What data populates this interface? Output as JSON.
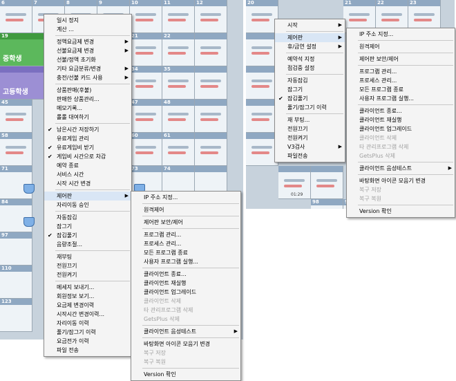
{
  "grid": {
    "top_row_numbers": [
      "6",
      "7",
      "8",
      "9",
      "10",
      "11",
      "12"
    ],
    "row19_number": "19",
    "row19_label": "중학생",
    "row32_label": "고등학생",
    "row45_number": "45",
    "row58_number": "58",
    "row71_number": "71",
    "row84_number": "84",
    "row97_number": "97",
    "row110_number": "110",
    "row123_number": "123",
    "col_numbers": [
      "21",
      "34",
      "47",
      "60",
      "73",
      "86",
      "99"
    ],
    "col2_numbers": [
      "22",
      "35",
      "48",
      "61",
      "74",
      "87",
      "100"
    ],
    "right_top_numbers": [
      "20",
      "21",
      "22",
      "23"
    ],
    "right_bottom_numbers": [
      "98",
      "99"
    ],
    "time_label": "01:29"
  },
  "menu_left": {
    "items": [
      {
        "label": "일시 정지",
        "checked": false,
        "submenu": false,
        "disabled": false
      },
      {
        "label": "계산 ...",
        "checked": false,
        "submenu": false,
        "disabled": false
      },
      {
        "sep": true
      },
      {
        "label": "정액요금제 변경",
        "checked": false,
        "submenu": true,
        "disabled": false
      },
      {
        "label": "선불요금제 변경",
        "checked": false,
        "submenu": true,
        "disabled": false
      },
      {
        "label": "선불/정액 초기화",
        "checked": false,
        "submenu": false,
        "disabled": false
      },
      {
        "label": "기타 요금분류/변경",
        "checked": false,
        "submenu": true,
        "disabled": false
      },
      {
        "label": "충전/선불 카드 사용",
        "checked": false,
        "submenu": true,
        "disabled": false
      },
      {
        "sep": true
      },
      {
        "label": "상품판매(후불)",
        "checked": false,
        "submenu": false,
        "disabled": false
      },
      {
        "label": "판매한 상품관리...",
        "checked": false,
        "submenu": false,
        "disabled": false
      },
      {
        "label": "메모기록...",
        "checked": false,
        "submenu": false,
        "disabled": false
      },
      {
        "label": "롤롤 대여하기",
        "checked": false,
        "submenu": false,
        "disabled": false
      },
      {
        "sep": true
      },
      {
        "label": "남은시간 저장하기",
        "checked": true,
        "submenu": false,
        "disabled": false
      },
      {
        "label": "유료게임 관리",
        "checked": false,
        "submenu": false,
        "disabled": false
      },
      {
        "label": "유료게임비 받기",
        "checked": true,
        "submenu": false,
        "disabled": false
      },
      {
        "label": "게임비 시간으로 차감",
        "checked": true,
        "submenu": false,
        "disabled": false
      },
      {
        "label": "예약 종료",
        "checked": false,
        "submenu": false,
        "disabled": false
      },
      {
        "label": "서비스 시간",
        "checked": false,
        "submenu": false,
        "disabled": false
      },
      {
        "label": "시작 시간 변경",
        "checked": false,
        "submenu": false,
        "disabled": false
      },
      {
        "sep": true
      },
      {
        "label": "제어판",
        "checked": false,
        "submenu": true,
        "disabled": false,
        "highlight": true
      },
      {
        "label": "자리이동 승인",
        "checked": false,
        "submenu": false,
        "disabled": false
      },
      {
        "sep": true
      },
      {
        "label": "자동잠김",
        "checked": false,
        "submenu": false,
        "disabled": false
      },
      {
        "label": "잠그기",
        "checked": false,
        "submenu": false,
        "disabled": false
      },
      {
        "label": "잠김풀기",
        "checked": true,
        "submenu": false,
        "disabled": false
      },
      {
        "label": "음량조절...",
        "checked": false,
        "submenu": false,
        "disabled": false
      },
      {
        "sep": true
      },
      {
        "label": "재부팅",
        "checked": false,
        "submenu": false,
        "disabled": false
      },
      {
        "label": "전원끄기",
        "checked": false,
        "submenu": false,
        "disabled": false
      },
      {
        "label": "전원켜기",
        "checked": false,
        "submenu": false,
        "disabled": false
      },
      {
        "sep": true
      },
      {
        "label": "메세지 보내기...",
        "checked": false,
        "submenu": false,
        "disabled": false
      },
      {
        "label": "회원정보 보기...",
        "checked": false,
        "submenu": false,
        "disabled": false
      },
      {
        "label": "요금제 변경이력",
        "checked": false,
        "submenu": false,
        "disabled": false
      },
      {
        "label": "시작시간 변경이력...",
        "checked": false,
        "submenu": false,
        "disabled": false
      },
      {
        "label": "자리이동 이력",
        "checked": false,
        "submenu": false,
        "disabled": false
      },
      {
        "label": "풀기/잠그기 이력",
        "checked": false,
        "submenu": false,
        "disabled": false
      },
      {
        "label": "요금전가 이력",
        "checked": false,
        "submenu": false,
        "disabled": false
      },
      {
        "label": "파일 전송",
        "checked": false,
        "submenu": false,
        "disabled": false
      }
    ]
  },
  "submenu_left": {
    "items": [
      {
        "label": "IP 주소 지정...",
        "disabled": false
      },
      {
        "sep": true
      },
      {
        "label": "원격제어",
        "disabled": false
      },
      {
        "sep": true
      },
      {
        "label": "제어판 보안/제어",
        "disabled": false
      },
      {
        "sep": true
      },
      {
        "label": "프로그램 관리...",
        "disabled": false
      },
      {
        "label": "프로세스 관리...",
        "disabled": false
      },
      {
        "label": "모든 프로그램 종료",
        "disabled": false
      },
      {
        "label": "사용자 프로그램 실행...",
        "disabled": false
      },
      {
        "sep": true
      },
      {
        "label": "클라이언트 종료...",
        "disabled": false
      },
      {
        "label": "클라이언트 재실행",
        "disabled": false
      },
      {
        "label": "클라이언트 업그레이드",
        "disabled": false
      },
      {
        "label": "클라이언트 삭제",
        "disabled": true
      },
      {
        "label": "타 관리프로그램 삭제",
        "disabled": true
      },
      {
        "label": "GetsPlus 삭제",
        "disabled": true
      },
      {
        "sep": true
      },
      {
        "label": "클라이언트 음성테스트",
        "disabled": false,
        "submenu": true
      },
      {
        "sep": true
      },
      {
        "label": "바탕화면 아이콘 모음기 변경",
        "disabled": false
      },
      {
        "label": "복구 저장",
        "disabled": true
      },
      {
        "label": "복구 복원",
        "disabled": true
      },
      {
        "sep": true
      },
      {
        "label": "Version 확인",
        "disabled": false
      }
    ]
  },
  "menu_right": {
    "items": [
      {
        "label": "시작",
        "checked": false,
        "submenu": true
      },
      {
        "sep": true
      },
      {
        "label": "제어판",
        "checked": false,
        "submenu": true,
        "highlight": true
      },
      {
        "label": "휴/금연 설정",
        "checked": false,
        "submenu": true
      },
      {
        "sep": true
      },
      {
        "label": "예약석 지정",
        "checked": false,
        "submenu": false
      },
      {
        "label": "점검중 설정",
        "checked": false,
        "submenu": false
      },
      {
        "sep": true
      },
      {
        "label": "자동잠김",
        "checked": false,
        "submenu": false
      },
      {
        "label": "잠그기",
        "checked": false,
        "submenu": false
      },
      {
        "label": "잠김풀기",
        "checked": true,
        "submenu": false
      },
      {
        "label": "풀기/잠그기 이력",
        "checked": false,
        "submenu": false
      },
      {
        "sep": true
      },
      {
        "label": "재 부팅...",
        "checked": false,
        "submenu": false
      },
      {
        "label": "전원끄기",
        "checked": false,
        "submenu": false
      },
      {
        "label": "전원켜기",
        "checked": false,
        "submenu": false
      },
      {
        "label": "V3검사",
        "checked": false,
        "submenu": true
      },
      {
        "label": "파일전송",
        "checked": false,
        "submenu": false
      }
    ]
  },
  "submenu_right": {
    "items": [
      {
        "label": "IP 주소 지정...",
        "disabled": false
      },
      {
        "sep": true
      },
      {
        "label": "원격제어",
        "disabled": false
      },
      {
        "sep": true
      },
      {
        "label": "제어판 보안/제어",
        "disabled": false
      },
      {
        "sep": true
      },
      {
        "label": "프로그램 관리...",
        "disabled": false
      },
      {
        "label": "프로세스 관리...",
        "disabled": false
      },
      {
        "label": "모든 프로그램 종료",
        "disabled": false
      },
      {
        "label": "사용자 프로그램 실행...",
        "disabled": false
      },
      {
        "sep": true
      },
      {
        "label": "클라이언트 종료...",
        "disabled": false
      },
      {
        "label": "클라이언트 재실행",
        "disabled": false
      },
      {
        "label": "클라이언트 업그레이드",
        "disabled": false
      },
      {
        "label": "클라이언트 삭제",
        "disabled": true
      },
      {
        "label": "타 관리프로그램 삭제",
        "disabled": true
      },
      {
        "label": "GetsPlus 삭제",
        "disabled": true
      },
      {
        "sep": true
      },
      {
        "label": "클라이언트 음성테스트",
        "disabled": false,
        "submenu": true
      },
      {
        "sep": true
      },
      {
        "label": "바탕화면 아이콘 모음기 변경",
        "disabled": false
      },
      {
        "label": "복구 저장",
        "disabled": true
      },
      {
        "label": "복구 복원",
        "disabled": true
      },
      {
        "sep": true
      },
      {
        "label": "Version 확인",
        "disabled": false
      }
    ]
  },
  "icons": {
    "check": "✔",
    "submenu_arrow": "▶"
  }
}
